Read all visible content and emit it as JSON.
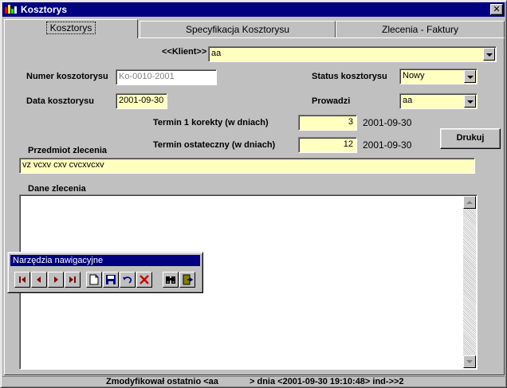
{
  "window": {
    "title": "Kosztorys",
    "close_glyph": "✕"
  },
  "tabs": [
    {
      "label": "Kosztorys",
      "active": true
    },
    {
      "label": "Specyfikacja Kosztorysu",
      "active": false
    },
    {
      "label": "Zlecenia - Faktury",
      "active": false
    }
  ],
  "form": {
    "klient_label": "<<Klient>>",
    "klient_value": "aa",
    "numer_label": "Numer koszotorysu",
    "numer_value": "Ko-0010-2001",
    "status_label": "Status kosztorysu",
    "status_value": "Nowy",
    "data_label": "Data kosztorysu",
    "data_value": "2001-09-30",
    "prowadzi_label": "Prowadzi",
    "prowadzi_value": "aa",
    "termin1_label": "Termin 1 korekty (w dniach)",
    "termin1_value": "3",
    "termin1_date": "2001-09-30",
    "termin2_label": "Termin ostateczny (w dniach)",
    "termin2_value": "12",
    "termin2_date": "2001-09-30",
    "print_label": "Drukuj",
    "przedmiot_label": "Przedmiot zlecenia",
    "przedmiot_value": "vz vcxv cxv cvcxvcxv",
    "dane_label": "Dane zlecenia",
    "dane_value": ""
  },
  "toolbox": {
    "title": "Narzędzia nawigacyjne",
    "buttons": [
      "first-record-icon",
      "prev-record-icon",
      "next-record-icon",
      "last-record-icon",
      "new-document-icon",
      "save-icon",
      "undo-icon",
      "delete-icon",
      "find-binoculars-icon",
      "exit-door-icon"
    ]
  },
  "status": {
    "modified_text": "Zmodyfikował ostatnio <aa",
    "date_text": "> dnia <2001-09-30 19:10:48> ind->>2"
  },
  "colors": {
    "titlebar": "#000080",
    "face": "#c0c0c0",
    "editable_field": "#ffffc0"
  }
}
